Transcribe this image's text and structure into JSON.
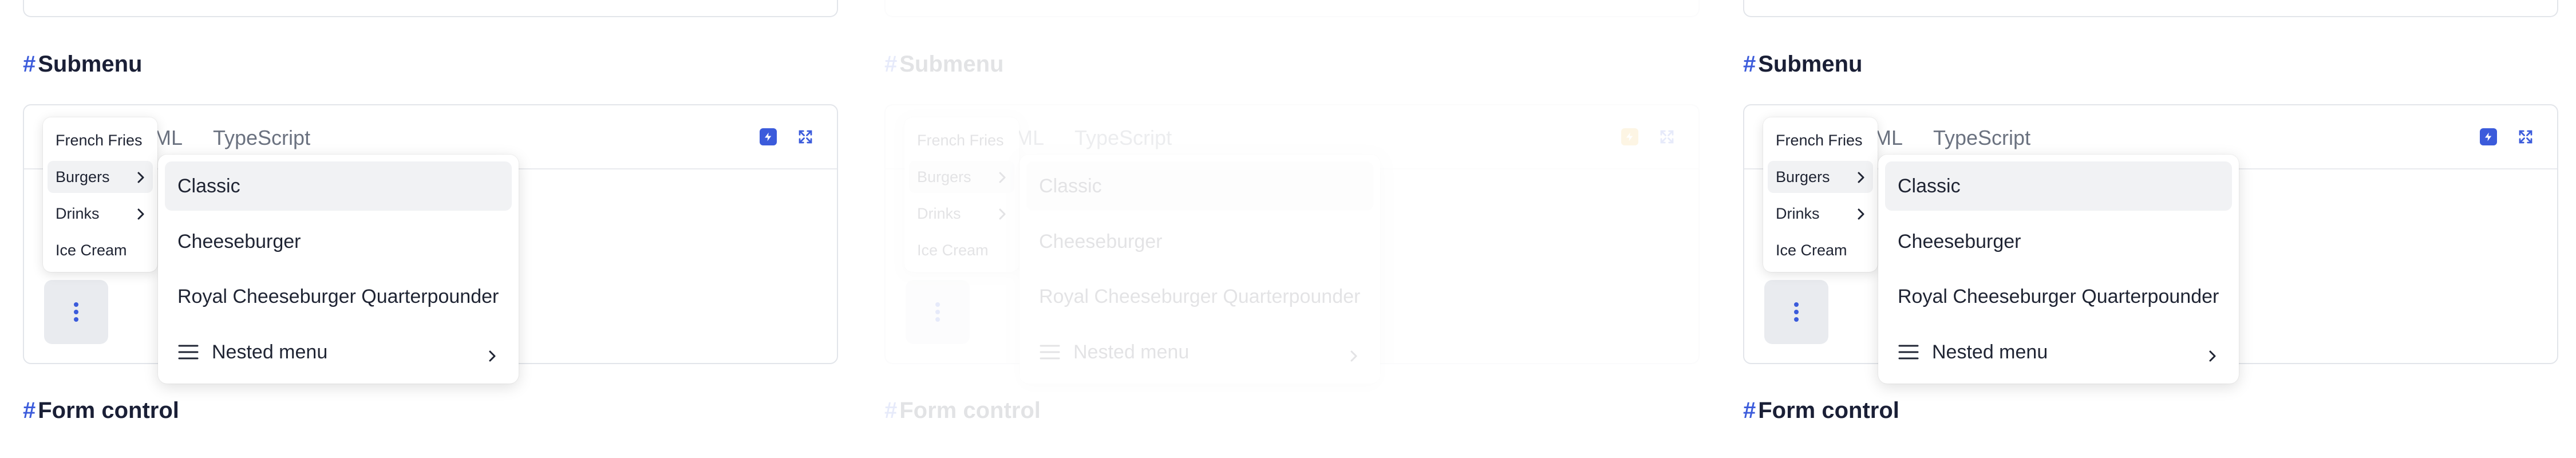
{
  "sections": {
    "submenu_title": "Submenu",
    "form_control_title": "Form control",
    "hash": "#"
  },
  "tabs": {
    "html": "TML",
    "typescript": "TypeScript"
  },
  "menu_level1": [
    {
      "label": "French Fries",
      "has_submenu": false
    },
    {
      "label": "Burgers",
      "has_submenu": true
    },
    {
      "label": "Drinks",
      "has_submenu": true
    },
    {
      "label": "Ice Cream",
      "has_submenu": false
    }
  ],
  "menu_level2": [
    {
      "label": "Classic"
    },
    {
      "label": "Cheeseburger"
    },
    {
      "label": "Royal Cheeseburger Quarterpounder"
    },
    {
      "label": "Nested menu",
      "icon": "hamburger-icon",
      "has_submenu": true
    }
  ],
  "colors": {
    "accent": "#3b5bdb",
    "zap_faded": "#f0b429"
  }
}
